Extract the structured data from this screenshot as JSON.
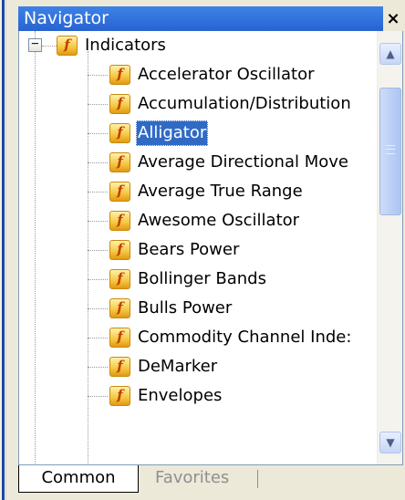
{
  "window": {
    "title": "Navigator",
    "close_label": "×"
  },
  "tree": {
    "root": {
      "label": "Indicators",
      "expander": "−",
      "icon": "function-icon"
    },
    "items": [
      {
        "label": "Accelerator Oscillator",
        "selected": false
      },
      {
        "label": "Accumulation/Distribution",
        "selected": false
      },
      {
        "label": "Alligator",
        "selected": true
      },
      {
        "label": "Average Directional Move",
        "selected": false
      },
      {
        "label": "Average True Range",
        "selected": false
      },
      {
        "label": "Awesome Oscillator",
        "selected": false
      },
      {
        "label": "Bears Power",
        "selected": false
      },
      {
        "label": "Bollinger Bands",
        "selected": false
      },
      {
        "label": "Bulls Power",
        "selected": false
      },
      {
        "label": "Commodity Channel Inde:",
        "selected": false
      },
      {
        "label": "DeMarker",
        "selected": false
      },
      {
        "label": "Envelopes",
        "selected": false
      }
    ],
    "icon_glyph": "f"
  },
  "scrollbar": {
    "up_icon": "▲",
    "down_icon": "▼"
  },
  "tabs": [
    {
      "label": "Common",
      "active": true
    },
    {
      "label": "Favorites",
      "active": false
    }
  ],
  "colors": {
    "title_bar": "#2f6fdc",
    "selection": "#316ac5"
  }
}
